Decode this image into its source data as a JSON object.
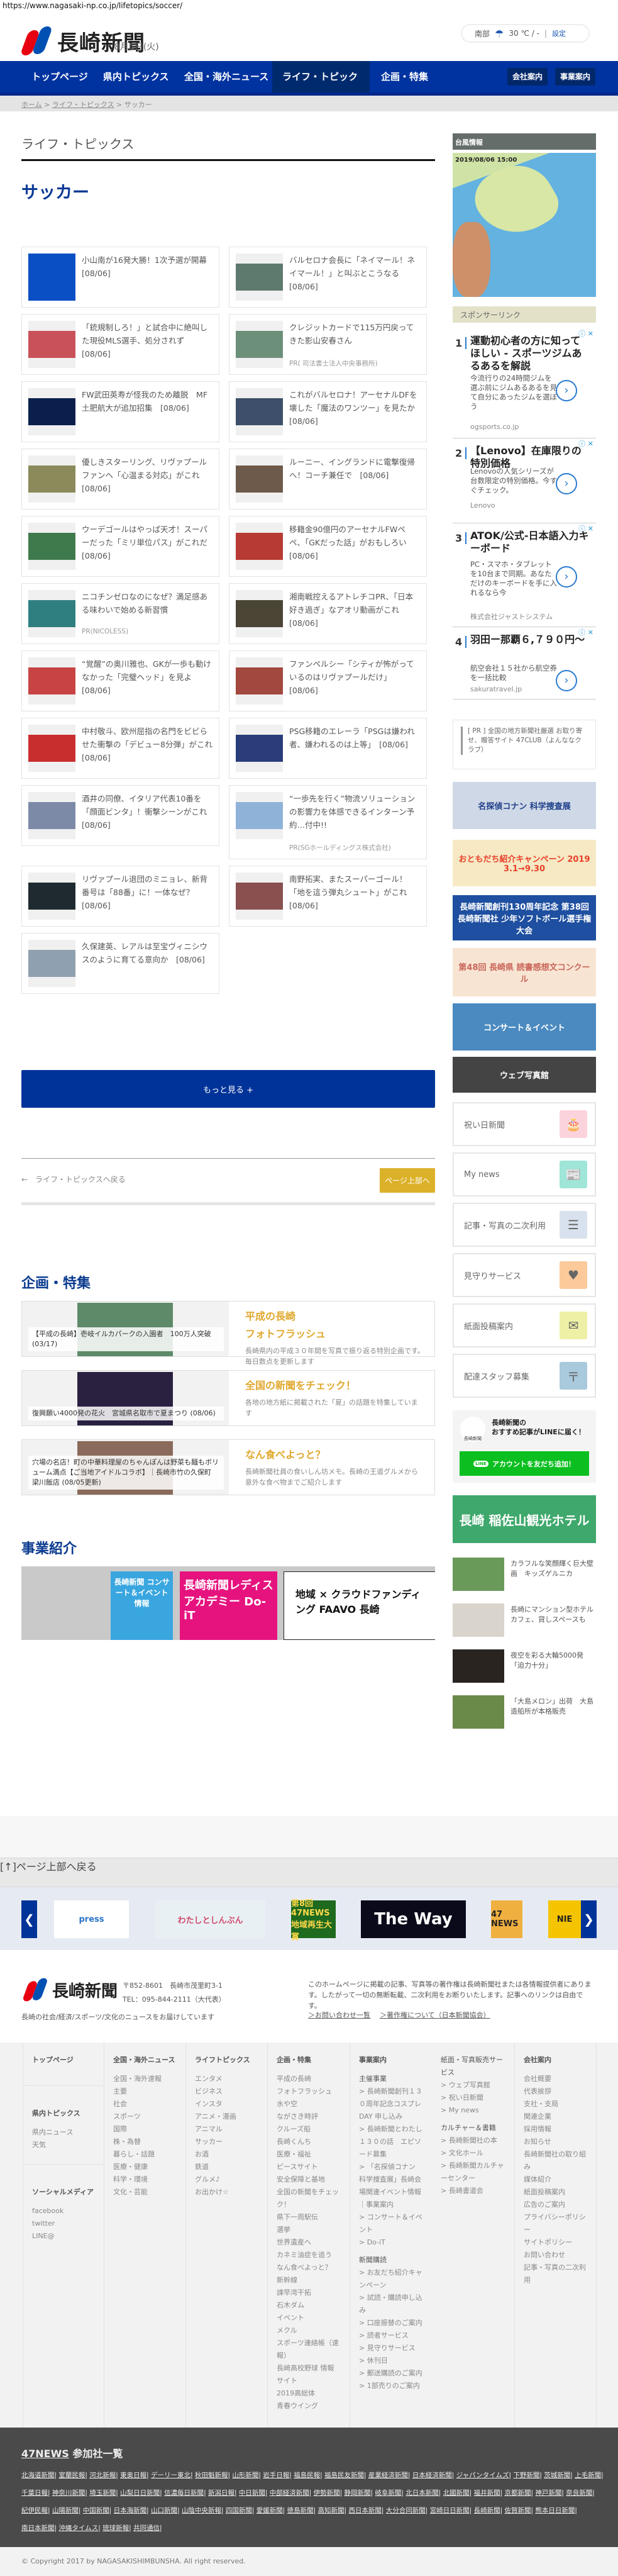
{
  "url": "https://www.nagasaki-np.co.jp/lifetopics/soccer/",
  "header": {
    "logo_text": "長崎新聞",
    "date": "8月6日(火)",
    "weather": {
      "region": "南部",
      "icon": "umbrella-icon",
      "temp": "30 ℃ / -",
      "settings": "設定"
    }
  },
  "nav": {
    "items": [
      "トップページ",
      "県内トピックス",
      "全国・海外ニュース",
      "ライフ・トピックス",
      "企画・特集"
    ],
    "active": 3,
    "buttons": [
      "会社案内",
      "事業案内"
    ]
  },
  "breadcrumb": [
    "ホーム",
    "ライフ・トピックス",
    "サッカー"
  ],
  "section_title": "ライフ・トピックス",
  "category_title": "サッカー",
  "articles": [
    {
      "title": "小山南が16発大勝！1次予選が開幕　[08/06]",
      "thumb_color": "#0b4fc4"
    },
    {
      "title": "バルセロナ会長に「ネイマール！ネイマール！」と叫ぶとこうなる　[08/06]",
      "thumb_color": "#5e7a6e"
    },
    {
      "title": "「銃規制しろ！」と試合中に絶叫した現役MLS選手、処分されず　[08/06]",
      "thumb_color": "#c9525a"
    },
    {
      "title": "クレジットカードで115万円戻ってきた影山安春さん",
      "pr": "PR( 司法書士法人中央事務所)",
      "thumb_color": "#6c8f7a"
    },
    {
      "title": "FW武田英寿が怪我のため離脱　MF土肥航大が追加招集　[08/06]",
      "thumb_color": "#0b1f4d"
    },
    {
      "title": "これがバルセロナ！アーセナルDFを壊した「魔法のワンツー」を見たか　[08/06]",
      "thumb_color": "#3d4f6a"
    },
    {
      "title": "優しきスターリング、リヴァプールファンへ「心温まる対応」がこれ　[08/06]",
      "thumb_color": "#8a8a5a"
    },
    {
      "title": "ルーニー、イングランドに電撃復帰へ！コーチ兼任で　[08/06]",
      "thumb_color": "#6e5a4a"
    },
    {
      "title": "ウーデゴールはやっぱ天才！スーパーだった「ミリ単位パス」がこれだ　[08/06]",
      "thumb_color": "#3f7a4c"
    },
    {
      "title": "移籍金90億円のアーセナルFWペペ、「GKだった話」がおもしろい　[08/06]",
      "thumb_color": "#b83a34"
    },
    {
      "title": "ニコチンゼロなのになぜ？満足感ある味わいで始める新習慣",
      "pr": "PR(NICOLESS)",
      "thumb_color": "#2f7f80"
    },
    {
      "title": "湘南戦控えるアトレチコPR、「日本好き過ぎ」なアオリ動画がこれ　[08/06]",
      "thumb_color": "#4a4535"
    },
    {
      "title": "“覚醒”の奥川雅也、GKが一歩も動けなかった「完璧ヘッド」を見よ　[08/06]",
      "thumb_color": "#c84444"
    },
    {
      "title": "ファンペルシー「シティが怖がっているのはリヴァプールだけ」　[08/06]",
      "thumb_color": "#a3483e"
    },
    {
      "title": "中村敬斗、欧州屈指の名門をビビらせた衝撃の「デビュー8分弾」がこれ　[08/06]",
      "thumb_color": "#c92e2e"
    },
    {
      "title": "PSG移籍のエレーラ「PSGは嫌われ者、嫌われるのは上等」　[08/06]",
      "thumb_color": "#2a3d7a"
    },
    {
      "title": "酒井の同僚、イタリア代表10番を「顔面ビンタ」！衝撃シーンがこれ　[08/06]",
      "thumb_color": "#7c8aa8"
    },
    {
      "title": "“一歩先を行く”物流ソリューションの影響力を体感できるインターン予約…付中!!",
      "pr": "PR(SGホールディングス株式会社)",
      "thumb_color": "#8fb3d8"
    },
    {
      "title": "リヴァプール退団のミニョレ、新背番号は「88番」に！一体なぜ？　[08/06]",
      "thumb_color": "#1f2a30"
    },
    {
      "title": "南野拓実、またスーパーゴール！「地を這う弾丸シュート」がこれ　[08/06]",
      "thumb_color": "#8a5050"
    },
    {
      "title": "久保建英、レアルは至宝ヴィニシウスのように育てる意向か　[08/06]",
      "thumb_color": "#8fa0b0"
    }
  ],
  "more_button": "もっと見る +",
  "back_link": "←　ライフ・トピックスへ戻る",
  "page_top_button": "ページ上部へ",
  "features_title": "企画・特集",
  "features": [
    {
      "title": [
        "平成の長崎",
        "フォトフラッシュ"
      ],
      "desc": "長崎県内の平成３０年間を写真で振り返る特別企画です。毎日数点を更新します",
      "caption": "【平成の長崎】壱岐イルカパークの入園者　100万人突破 (03/17)",
      "color": "#5f8a6a"
    },
    {
      "title": [
        "全国の新聞をチェック！"
      ],
      "desc": "各地の地方紙に掲載された「夏」の話題を特集しています",
      "caption": "復興願い4000発の花火　宮城県名取市で夏まつり (08/06)",
      "color": "#2a2040"
    },
    {
      "title": [
        "なん食べよっと？"
      ],
      "desc": "長崎新聞社員の食いしん坊メモ。長崎の王道グルメから意外な食べ物までご紹介します",
      "caption": "穴場の名店！町の中華料理屋のちゃんぽんは野菜も麺もボリューム満点【ご当地アイドルコラボ】｜長崎市竹の久保町 梁川飯店 (08/05更新)",
      "color": "#8a6a5a"
    }
  ],
  "business_title": "事業紹介",
  "business_banners": [
    {
      "label": "長崎新聞 コンサート＆イベント情報",
      "color": "#39a6e0"
    },
    {
      "label": "長崎新聞レディスアカデミー Do-iT",
      "color": "#e6137f"
    },
    {
      "label": "地域 × クラウドファンディング FAAVO 長崎",
      "color": "#ffffff"
    }
  ],
  "sidebar": {
    "typhoon_title": "台風情報",
    "typhoon_timestamp": "2019/08/06 15:00",
    "sponsor_title": "スポンサーリンク",
    "ads": [
      {
        "num": "1",
        "title": "運動初心者の方に知ってほしい - スポーツジムあるあるを解説",
        "desc": "今流行りの24時間ジムを選ぶ前にジムあるあるを見て自分にあったジムを選ぼう",
        "source": "ogsports.co.jp"
      },
      {
        "num": "2",
        "title": "【Lenovo】在庫限りの特別価格",
        "desc": "Lenovoの人気シリーズが台数限定の特別価格。今すぐチェック。",
        "source": "Lenovo"
      },
      {
        "num": "3",
        "title": "ATOK/公式-日本語入力キーボード",
        "desc": "PC・スマホ・タブレットを10台まで同期。あなただけのキーボードを手に入れるなら今",
        "source": "株式会社ジャストシステム"
      },
      {
        "num": "4",
        "title": "羽田ー那覇６,７９０円〜",
        "desc": "航空会社１５社から航空券を一括比較",
        "source": "sakuratravel.jp"
      }
    ],
    "pr_text": "[ PR ] 全国の地方新聞社厳選 お取り寄せ、贈答サイト 47CLUB（よんななクラブ）",
    "banners": [
      {
        "label": "名探偵コナン 科学捜査展",
        "color": "#cfd8e6"
      },
      {
        "label": "おともだち紹介キャンペーン 2019 3.1→9.30",
        "color": "#f6e9c4"
      },
      {
        "label": "長崎新聞創刊130周年記念 第38回 長崎新聞社 少年ソフトボール選手権大会",
        "color": "#1e4fa0"
      },
      {
        "label": "第48回 長崎県 読書感想文コンクール",
        "color": "#f8e4d2"
      },
      {
        "label": "コンサート＆イベント",
        "color": "#4a8ac0"
      },
      {
        "label": "ウェブ写真館",
        "color": "#444444"
      }
    ],
    "services": [
      {
        "label": "祝い日新聞",
        "icon": "cake-icon",
        "color": "#fbd3dc",
        "glyph": "🎂"
      },
      {
        "label": "My news",
        "icon": "newspaper-icon",
        "color": "#9fe5d8",
        "glyph": "📰"
      },
      {
        "label": "記事・写真の二次利用",
        "icon": "document-icon",
        "color": "#d8e2ee",
        "glyph": "☰"
      },
      {
        "label": "見守りサービス",
        "icon": "heart-icon",
        "color": "#fcc99a",
        "glyph": "♥"
      },
      {
        "label": "紙面投稿案内",
        "icon": "mail-icon",
        "color": "#eef0a6",
        "glyph": "✉"
      },
      {
        "label": "配達スタッフ募集",
        "icon": "mailbox-icon",
        "color": "#a9c9dc",
        "glyph": "〒"
      }
    ],
    "line": {
      "text": "長崎新聞の\nおすすめ記事がLINEに届く！",
      "button": "アカウントを友だち追加！"
    },
    "hotel_banner": "長崎 稲佐山観光ホテル",
    "news": [
      {
        "title": "カラフルな笑顔輝く巨大壁画　キッズゲルニカ",
        "color": "#6a9a5a"
      },
      {
        "title": "長崎にマンション型ホテル　カフェ、貸しスペースも",
        "color": "#d9d4cc"
      },
      {
        "title": "夜空を彩る大輪5000発「迫力十分」",
        "color": "#2a2420"
      },
      {
        "title": "「大島メロン」出荷　大島造船所が本格販売",
        "color": "#6a8a4a"
      }
    ]
  },
  "footer": {
    "page_top": "[↑]ページ上部へ戻る",
    "carousel": [
      {
        "label": "press",
        "color": "#2a73c8",
        "bg": "#ffffff"
      },
      {
        "label": "わたしとしんぶん",
        "color": "#d04a6a",
        "bg": "#e8f0f4"
      },
      {
        "label": "第8回 47NEWS 地域再生大賞",
        "color": "#ffd84a",
        "bg": "#1e6a1e"
      },
      {
        "label": "The Way",
        "color": "#ffffff",
        "bg": "#0a0a1a"
      },
      {
        "label": "47 NEWS",
        "color": "#222222",
        "bg": "#f0b040"
      },
      {
        "label": "NIE",
        "color": "#222222",
        "bg": "#f5c400"
      }
    ],
    "address": "〒852-8601　長崎市茂里町3-1",
    "tel": "TEL：095-844-2111（大代表）",
    "tagline": "長崎の社会/経済/スポーツ/文化のニュースをお届けしています",
    "copyright_notice": "このホームページに掲載の記事、写真等の著作権は長崎新聞社または各情報提供者にあります。したがって一切の無断転載、二次利用をお断りいたします。記事へのリンクは自由です。",
    "links": [
      "＞お問い合わせ一覧",
      "＞著作権について（日本新聞協会）"
    ],
    "sitemap": {
      "col1": [
        {
          "head": "トップページ",
          "items": []
        },
        {
          "head": "県内トピックス",
          "items": [
            "県内ニュース",
            "天気"
          ]
        },
        {
          "head": "ソーシャルメディア",
          "items": [
            "facebook",
            "twitter",
            "LINE@"
          ]
        }
      ],
      "col2": {
        "head": "全国・海外ニュース",
        "items": [
          "全国・海外速報",
          "主要",
          "社会",
          "スポーツ",
          "国際",
          "株・為替",
          "暮らし・話題",
          "医療・健康",
          "科学・環境",
          "文化・芸能"
        ]
      },
      "col3": {
        "head": "ライフトピックス",
        "items": [
          "エンタメ",
          "ビジネス",
          "インスタ",
          "アニメ・漫画",
          "アニマル",
          "サッカー",
          "お酒",
          "鉄道",
          "グルメ♪",
          "お出かけ☆"
        ]
      },
      "col4": {
        "head": "企画・特集",
        "items": [
          "平成の長崎",
          "フォトフラッシュ",
          "水や空",
          "ながさき時評",
          "クルーズ船",
          "長崎くんち",
          "医療・福祉",
          "ピースサイト",
          "安全保障と基地",
          "全国の新聞をチェック！",
          "県下一周駅伝",
          "選挙",
          "世界遺産へ",
          "カネミ油症を追う",
          "なん食べよっと？",
          "新幹線",
          "諫早湾干拓",
          "石木ダム",
          "イベント",
          "メクル",
          "スポーツ連絡帳（速報）",
          "長崎高校野球 情報サイト",
          "2019高総体",
          "青春ウイング"
        ]
      },
      "col5a": {
        "head": "事業案内",
        "items": [
          "主催事業",
          "> 長崎新聞創刊１３０周年記念コスプレDAY 申し込み",
          "> 長崎新聞とわたし　１３０の話　エピソード募集",
          "> 「名探偵コナン 科学捜査展」長崎会場関連イベント情報｜事業案内",
          "> コンサート＆イベント",
          "> Do-iT",
          "新聞購読",
          "> お友だち紹介キャンペーン",
          "> 試読・購読申し込み",
          "> 口座振替のご案内",
          "> 読者サービス",
          "> 見守りサービス",
          "> 休刊日",
          "> 郵送購読のご案内",
          "> 1部売りのご案内"
        ]
      },
      "col5b": {
        "items": [
          "紙面・写真販売サービス",
          "> ウェブ写真館",
          "> 祝い日新聞",
          "> My news",
          "カルチャー＆書籍",
          "> 長崎新聞社の本",
          "> 文化ホール",
          "> 長崎新聞カルチャーセンター",
          "> 長崎書道会"
        ]
      },
      "col6": {
        "head": "会社案内",
        "items": [
          "会社概要",
          "代表挨拶",
          "支社・支局",
          "関連企業",
          "採用情報",
          "お知らせ",
          "長崎新聞社の取り組み",
          "媒体紹介",
          "紙面投稿案内",
          "広告のご案内",
          "プライバシーポリシー",
          "サイトポリシー",
          "お問い合わせ",
          "記事・写真の二次利用"
        ]
      }
    },
    "news47": {
      "title_link": "47NEWS",
      "title_rest": " 参加社一覧",
      "rows": [
        [
          "北海道新聞",
          "室蘭民報",
          "河北新報",
          "東奥日報",
          "デーリー東北",
          "秋田魁新報",
          "山形新聞",
          "岩手日報",
          "福島民報",
          "福島民友新聞",
          "産業経済新聞",
          "日本経済新聞",
          "ジャパンタイムズ",
          "下野新聞",
          "茨城新聞",
          "上毛新聞"
        ],
        [
          "千葉日報",
          "神奈川新聞",
          "埼玉新聞",
          "山梨日日新聞",
          "信濃毎日新聞",
          "新潟日報",
          "中日新聞",
          "中部経済新聞",
          "伊勢新聞",
          "静岡新聞",
          "岐阜新聞",
          "北日本新聞",
          "北國新聞",
          "福井新聞",
          "京都新聞",
          "神戸新聞",
          "奈良新聞"
        ],
        [
          "紀伊民報",
          "山陽新聞",
          "中国新聞",
          "日本海新聞",
          "山口新聞",
          "山陰中央新報",
          "四国新聞",
          "愛媛新聞",
          "徳島新聞",
          "高知新聞",
          "西日本新聞",
          "大分合同新聞",
          "宮崎日日新聞",
          "長崎新聞",
          "佐賀新聞",
          "熊本日日新聞"
        ],
        [
          "南日本新聞",
          "沖縄タイムス",
          "琉球新報",
          "共同通信"
        ]
      ]
    },
    "copyright": "© Copyright 2017 by NAGASAKISHIMBUNSHA. All right reserved."
  }
}
